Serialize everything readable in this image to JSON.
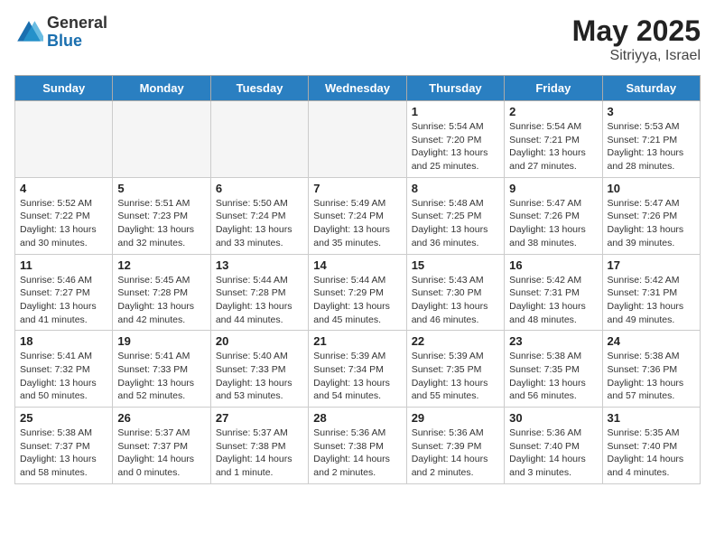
{
  "header": {
    "logo_line1": "General",
    "logo_line2": "Blue",
    "month_year": "May 2025",
    "location": "Sitriyya, Israel"
  },
  "days_of_week": [
    "Sunday",
    "Monday",
    "Tuesday",
    "Wednesday",
    "Thursday",
    "Friday",
    "Saturday"
  ],
  "weeks": [
    [
      {
        "day": "",
        "empty": true
      },
      {
        "day": "",
        "empty": true
      },
      {
        "day": "",
        "empty": true
      },
      {
        "day": "",
        "empty": true
      },
      {
        "day": "1",
        "sunrise": "5:54 AM",
        "sunset": "7:20 PM",
        "daylight": "13 hours and 25 minutes."
      },
      {
        "day": "2",
        "sunrise": "5:54 AM",
        "sunset": "7:21 PM",
        "daylight": "13 hours and 27 minutes."
      },
      {
        "day": "3",
        "sunrise": "5:53 AM",
        "sunset": "7:21 PM",
        "daylight": "13 hours and 28 minutes."
      }
    ],
    [
      {
        "day": "4",
        "sunrise": "5:52 AM",
        "sunset": "7:22 PM",
        "daylight": "13 hours and 30 minutes."
      },
      {
        "day": "5",
        "sunrise": "5:51 AM",
        "sunset": "7:23 PM",
        "daylight": "13 hours and 32 minutes."
      },
      {
        "day": "6",
        "sunrise": "5:50 AM",
        "sunset": "7:24 PM",
        "daylight": "13 hours and 33 minutes."
      },
      {
        "day": "7",
        "sunrise": "5:49 AM",
        "sunset": "7:24 PM",
        "daylight": "13 hours and 35 minutes."
      },
      {
        "day": "8",
        "sunrise": "5:48 AM",
        "sunset": "7:25 PM",
        "daylight": "13 hours and 36 minutes."
      },
      {
        "day": "9",
        "sunrise": "5:47 AM",
        "sunset": "7:26 PM",
        "daylight": "13 hours and 38 minutes."
      },
      {
        "day": "10",
        "sunrise": "5:47 AM",
        "sunset": "7:26 PM",
        "daylight": "13 hours and 39 minutes."
      }
    ],
    [
      {
        "day": "11",
        "sunrise": "5:46 AM",
        "sunset": "7:27 PM",
        "daylight": "13 hours and 41 minutes."
      },
      {
        "day": "12",
        "sunrise": "5:45 AM",
        "sunset": "7:28 PM",
        "daylight": "13 hours and 42 minutes."
      },
      {
        "day": "13",
        "sunrise": "5:44 AM",
        "sunset": "7:28 PM",
        "daylight": "13 hours and 44 minutes."
      },
      {
        "day": "14",
        "sunrise": "5:44 AM",
        "sunset": "7:29 PM",
        "daylight": "13 hours and 45 minutes."
      },
      {
        "day": "15",
        "sunrise": "5:43 AM",
        "sunset": "7:30 PM",
        "daylight": "13 hours and 46 minutes."
      },
      {
        "day": "16",
        "sunrise": "5:42 AM",
        "sunset": "7:31 PM",
        "daylight": "13 hours and 48 minutes."
      },
      {
        "day": "17",
        "sunrise": "5:42 AM",
        "sunset": "7:31 PM",
        "daylight": "13 hours and 49 minutes."
      }
    ],
    [
      {
        "day": "18",
        "sunrise": "5:41 AM",
        "sunset": "7:32 PM",
        "daylight": "13 hours and 50 minutes."
      },
      {
        "day": "19",
        "sunrise": "5:41 AM",
        "sunset": "7:33 PM",
        "daylight": "13 hours and 52 minutes."
      },
      {
        "day": "20",
        "sunrise": "5:40 AM",
        "sunset": "7:33 PM",
        "daylight": "13 hours and 53 minutes."
      },
      {
        "day": "21",
        "sunrise": "5:39 AM",
        "sunset": "7:34 PM",
        "daylight": "13 hours and 54 minutes."
      },
      {
        "day": "22",
        "sunrise": "5:39 AM",
        "sunset": "7:35 PM",
        "daylight": "13 hours and 55 minutes."
      },
      {
        "day": "23",
        "sunrise": "5:38 AM",
        "sunset": "7:35 PM",
        "daylight": "13 hours and 56 minutes."
      },
      {
        "day": "24",
        "sunrise": "5:38 AM",
        "sunset": "7:36 PM",
        "daylight": "13 hours and 57 minutes."
      }
    ],
    [
      {
        "day": "25",
        "sunrise": "5:38 AM",
        "sunset": "7:37 PM",
        "daylight": "13 hours and 58 minutes."
      },
      {
        "day": "26",
        "sunrise": "5:37 AM",
        "sunset": "7:37 PM",
        "daylight": "14 hours and 0 minutes."
      },
      {
        "day": "27",
        "sunrise": "5:37 AM",
        "sunset": "7:38 PM",
        "daylight": "14 hours and 1 minute."
      },
      {
        "day": "28",
        "sunrise": "5:36 AM",
        "sunset": "7:38 PM",
        "daylight": "14 hours and 2 minutes."
      },
      {
        "day": "29",
        "sunrise": "5:36 AM",
        "sunset": "7:39 PM",
        "daylight": "14 hours and 2 minutes."
      },
      {
        "day": "30",
        "sunrise": "5:36 AM",
        "sunset": "7:40 PM",
        "daylight": "14 hours and 3 minutes."
      },
      {
        "day": "31",
        "sunrise": "5:35 AM",
        "sunset": "7:40 PM",
        "daylight": "14 hours and 4 minutes."
      }
    ]
  ],
  "labels": {
    "sunrise": "Sunrise:",
    "sunset": "Sunset:",
    "daylight": "Daylight:"
  }
}
